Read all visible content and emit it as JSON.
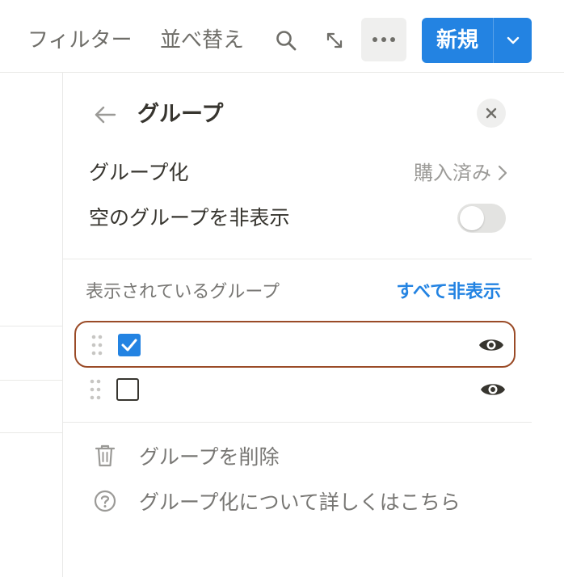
{
  "toolbar": {
    "filter_label": "フィルター",
    "sort_label": "並べ替え",
    "search_icon": "search-icon",
    "expand_icon": "expand-icon",
    "more_icon": "more-icon",
    "new_label": "新規",
    "new_dropdown_icon": "chevron-down-icon"
  },
  "panel": {
    "title": "グループ",
    "group_by": {
      "label": "グループ化",
      "value": "購入済み"
    },
    "hide_empty": {
      "label": "空のグループを非表示",
      "enabled": false
    },
    "visible_groups": {
      "heading": "表示されているグループ",
      "hide_all_label": "すべて非表示",
      "items": [
        {
          "checked": true,
          "visible": true,
          "highlighted": true
        },
        {
          "checked": false,
          "visible": true,
          "highlighted": false
        }
      ]
    },
    "actions": {
      "delete_label": "グループを削除",
      "help_label": "グループ化について詳しくはこちら"
    }
  },
  "colors": {
    "accent": "#2383e2",
    "highlight_border": "#9a4b27",
    "text_primary": "#37352f",
    "text_secondary": "#787774"
  }
}
